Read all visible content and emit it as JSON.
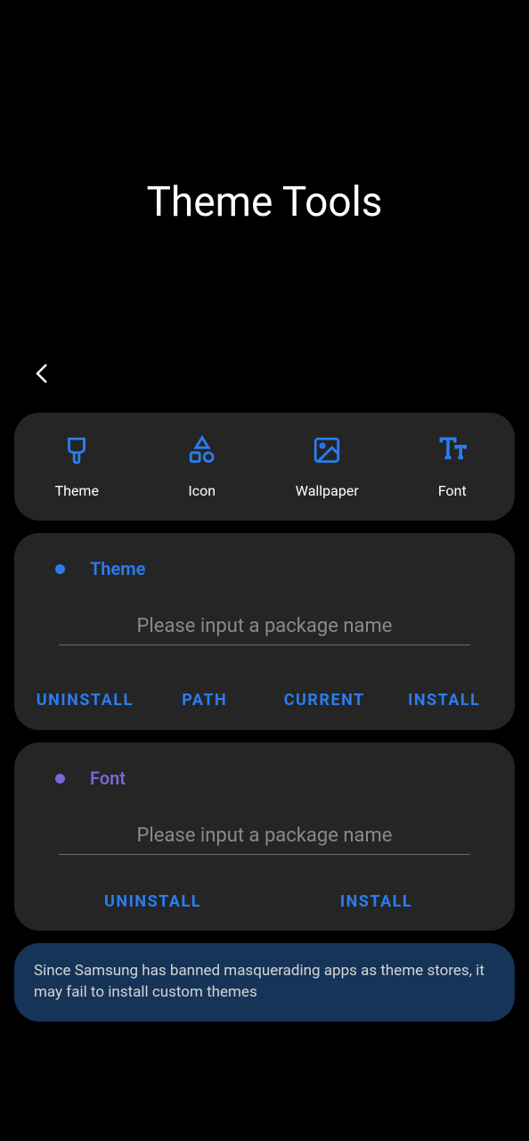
{
  "header": {
    "title": "Theme Tools"
  },
  "categories": [
    {
      "label": "Theme",
      "icon": "brush"
    },
    {
      "label": "Icon",
      "icon": "shapes"
    },
    {
      "label": "Wallpaper",
      "icon": "image"
    },
    {
      "label": "Font",
      "icon": "text"
    }
  ],
  "theme_section": {
    "title": "Theme",
    "placeholder": "Please input a package name",
    "buttons": {
      "uninstall": "UNINSTALL",
      "path": "PATH",
      "current": "CURRENT",
      "install": "INSTALL"
    }
  },
  "font_section": {
    "title": "Font",
    "placeholder": "Please input a package name",
    "buttons": {
      "uninstall": "UNINSTALL",
      "install": "INSTALL"
    }
  },
  "info_banner": {
    "text": "Since Samsung has banned masquerading apps as theme stores, it may fail to install custom themes"
  },
  "colors": {
    "accent_blue": "#2a7df2",
    "accent_purple": "#7966d6",
    "banner_bg": "#153457",
    "card_bg": "#252525"
  }
}
